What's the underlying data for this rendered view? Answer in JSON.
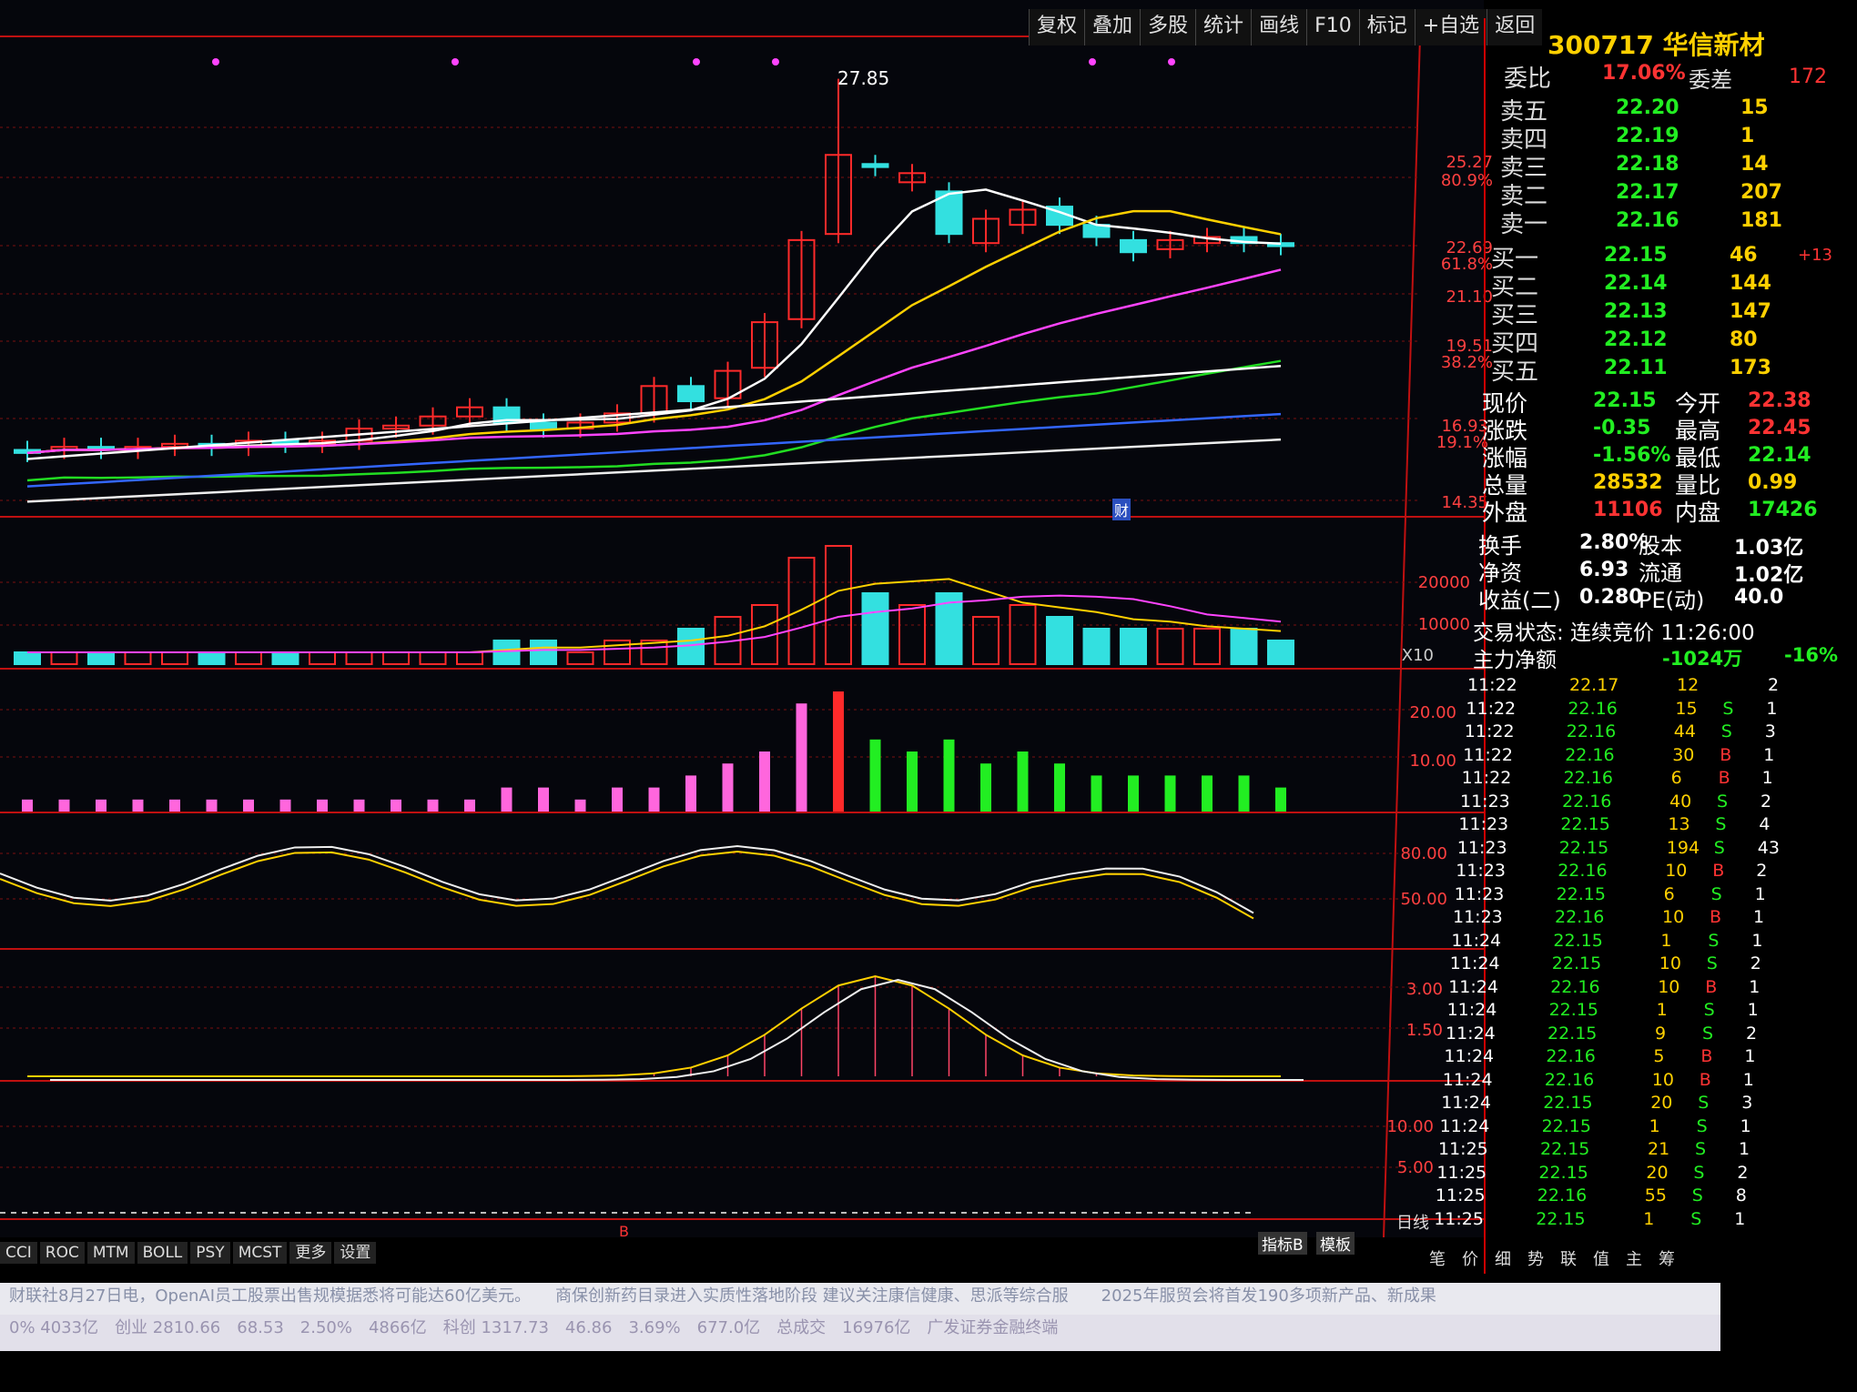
{
  "toolbar": [
    "复权",
    "叠加",
    "多股",
    "统计",
    "画线",
    "F10",
    "标记",
    "+自选",
    "返回"
  ],
  "stock": {
    "code_name": "300717 华信新材"
  },
  "weibi": {
    "label": "委比",
    "value": "17.06%",
    "label2": "委差",
    "value2": "172"
  },
  "asks": [
    {
      "label": "卖五",
      "price": "22.20",
      "vol": "15"
    },
    {
      "label": "卖四",
      "price": "22.19",
      "vol": "1"
    },
    {
      "label": "卖三",
      "price": "22.18",
      "vol": "14"
    },
    {
      "label": "卖二",
      "price": "22.17",
      "vol": "207"
    },
    {
      "label": "卖一",
      "price": "22.16",
      "vol": "181"
    }
  ],
  "bids": [
    {
      "label": "买一",
      "price": "22.15",
      "vol": "46",
      "extra": "+13"
    },
    {
      "label": "买二",
      "price": "22.14",
      "vol": "144",
      "extra": ""
    },
    {
      "label": "买三",
      "price": "22.13",
      "vol": "147",
      "extra": ""
    },
    {
      "label": "买四",
      "price": "22.12",
      "vol": "80",
      "extra": ""
    },
    {
      "label": "买五",
      "price": "22.11",
      "vol": "173",
      "extra": ""
    }
  ],
  "quote": [
    {
      "l1": "现价",
      "v1": "22.15",
      "l2": "今开",
      "v2": "22.38"
    },
    {
      "l1": "涨跌",
      "v1": "-0.35",
      "l2": "最高",
      "v2": "22.45"
    },
    {
      "l1": "涨幅",
      "v1": "-1.56%",
      "l2": "最低",
      "v2": "22.14"
    },
    {
      "l1": "总量",
      "v1": "28532",
      "l2": "量比",
      "v2": "0.99"
    },
    {
      "l1": "外盘",
      "v1": "11106",
      "l2": "内盘",
      "v2": "17426"
    }
  ],
  "fund": [
    {
      "l1": "换手",
      "v1": "2.80%",
      "l2": "股本",
      "v2": "1.03亿"
    },
    {
      "l1": "净资",
      "v1": "6.93",
      "l2": "流通",
      "v2": "1.02亿"
    },
    {
      "l1": "收益(二)",
      "v1": "0.280",
      "l2": "PE(动)",
      "v2": "40.0"
    }
  ],
  "trade_status": "交易状态: 连续竞价 11:26:00",
  "main_flow": {
    "label": "主力净额",
    "value": "-1024万",
    "pct": "-16%"
  },
  "ticks": [
    {
      "t": "11:22",
      "p": "22.17",
      "v": "12",
      "s": "",
      "n": "2"
    },
    {
      "t": "11:22",
      "p": "22.16",
      "v": "15",
      "s": "S",
      "n": "1"
    },
    {
      "t": "11:22",
      "p": "22.16",
      "v": "44",
      "s": "S",
      "n": "3"
    },
    {
      "t": "11:22",
      "p": "22.16",
      "v": "30",
      "s": "B",
      "n": "1"
    },
    {
      "t": "11:22",
      "p": "22.16",
      "v": "6",
      "s": "B",
      "n": "1"
    },
    {
      "t": "11:23",
      "p": "22.16",
      "v": "40",
      "s": "S",
      "n": "2"
    },
    {
      "t": "11:23",
      "p": "22.15",
      "v": "13",
      "s": "S",
      "n": "4"
    },
    {
      "t": "11:23",
      "p": "22.15",
      "v": "194",
      "s": "S",
      "n": "43"
    },
    {
      "t": "11:23",
      "p": "22.16",
      "v": "10",
      "s": "B",
      "n": "2"
    },
    {
      "t": "11:23",
      "p": "22.15",
      "v": "6",
      "s": "S",
      "n": "1"
    },
    {
      "t": "11:23",
      "p": "22.16",
      "v": "10",
      "s": "B",
      "n": "1"
    },
    {
      "t": "11:24",
      "p": "22.15",
      "v": "1",
      "s": "S",
      "n": "1"
    },
    {
      "t": "11:24",
      "p": "22.15",
      "v": "10",
      "s": "S",
      "n": "2"
    },
    {
      "t": "11:24",
      "p": "22.16",
      "v": "10",
      "s": "B",
      "n": "1"
    },
    {
      "t": "11:24",
      "p": "22.15",
      "v": "1",
      "s": "S",
      "n": "1"
    },
    {
      "t": "11:24",
      "p": "22.15",
      "v": "9",
      "s": "S",
      "n": "2"
    },
    {
      "t": "11:24",
      "p": "22.16",
      "v": "5",
      "s": "B",
      "n": "1"
    },
    {
      "t": "11:24",
      "p": "22.16",
      "v": "10",
      "s": "B",
      "n": "1"
    },
    {
      "t": "11:24",
      "p": "22.15",
      "v": "20",
      "s": "S",
      "n": "3"
    },
    {
      "t": "11:24",
      "p": "22.15",
      "v": "1",
      "s": "S",
      "n": "1"
    },
    {
      "t": "11:25",
      "p": "22.15",
      "v": "21",
      "s": "S",
      "n": "1"
    },
    {
      "t": "11:25",
      "p": "22.15",
      "v": "20",
      "s": "S",
      "n": "2"
    },
    {
      "t": "11:25",
      "p": "22.16",
      "v": "55",
      "s": "S",
      "n": "8"
    },
    {
      "t": "11:25",
      "p": "22.15",
      "v": "1",
      "s": "S",
      "n": "1"
    }
  ],
  "axis": {
    "price": [
      {
        "v": "25.27",
        "pct": "80.9%"
      },
      {
        "v": "22.69",
        "pct": "61.8%"
      },
      {
        "v": "21.10",
        "pct": ""
      },
      {
        "v": "19.51",
        "pct": "38.2%"
      },
      {
        "v": "16.93",
        "pct": "19.1%"
      },
      {
        "v": "14.35",
        "pct": ""
      }
    ],
    "volume": [
      "20000",
      "10000",
      "X10"
    ],
    "ind1": [
      "20.00",
      "10.00"
    ],
    "ind2": [
      "80.00",
      "50.00"
    ],
    "ind3": [
      "3.00",
      "1.50"
    ],
    "ind4": [
      "10.00",
      "5.00"
    ],
    "period": "日线"
  },
  "annotations": {
    "high_label": "27.85",
    "cai": "财",
    "b_marker": "B"
  },
  "chart_data": {
    "type": "candlestick",
    "candles": [
      {
        "o": 15.6,
        "c": 15.5
      },
      {
        "o": 15.6,
        "c": 15.7
      },
      {
        "o": 15.7,
        "c": 15.6
      },
      {
        "o": 15.6,
        "c": 15.7
      },
      {
        "o": 15.7,
        "c": 15.8
      },
      {
        "o": 15.8,
        "c": 15.7
      },
      {
        "o": 15.7,
        "c": 15.9
      },
      {
        "o": 15.9,
        "c": 15.8
      },
      {
        "o": 15.8,
        "c": 15.9
      },
      {
        "o": 15.9,
        "c": 16.3
      },
      {
        "o": 16.3,
        "c": 16.4
      },
      {
        "o": 16.4,
        "c": 16.7
      },
      {
        "o": 16.7,
        "c": 17.0
      },
      {
        "o": 17.0,
        "c": 16.5
      },
      {
        "o": 16.5,
        "c": 16.3
      },
      {
        "o": 16.3,
        "c": 16.5
      },
      {
        "o": 16.5,
        "c": 16.8
      },
      {
        "o": 16.8,
        "c": 17.7
      },
      {
        "o": 17.7,
        "c": 17.2
      },
      {
        "o": 17.3,
        "c": 18.2
      },
      {
        "o": 18.3,
        "c": 19.8
      },
      {
        "o": 19.9,
        "c": 22.5
      },
      {
        "o": 22.7,
        "c": 25.3
      },
      {
        "o": 25.0,
        "c": 24.9
      },
      {
        "o": 24.4,
        "c": 24.7
      },
      {
        "o": 24.1,
        "c": 22.7
      },
      {
        "o": 22.4,
        "c": 23.2
      },
      {
        "o": 23.0,
        "c": 23.5
      },
      {
        "o": 23.6,
        "c": 23.0
      },
      {
        "o": 23.0,
        "c": 22.6
      },
      {
        "o": 22.5,
        "c": 22.1
      },
      {
        "o": 22.2,
        "c": 22.5
      },
      {
        "o": 22.4,
        "c": 22.6
      },
      {
        "o": 22.6,
        "c": 22.4
      },
      {
        "o": 22.4,
        "c": 22.3
      }
    ],
    "high": "27.85",
    "volume_bars": [
      1,
      1,
      1,
      1,
      1,
      1,
      1,
      1,
      1,
      1,
      1,
      1,
      1,
      2,
      2,
      1,
      2,
      2,
      3,
      4,
      5,
      9,
      10,
      6,
      5,
      6,
      4,
      5,
      4,
      3,
      3,
      3,
      3,
      3,
      2
    ]
  }
}
